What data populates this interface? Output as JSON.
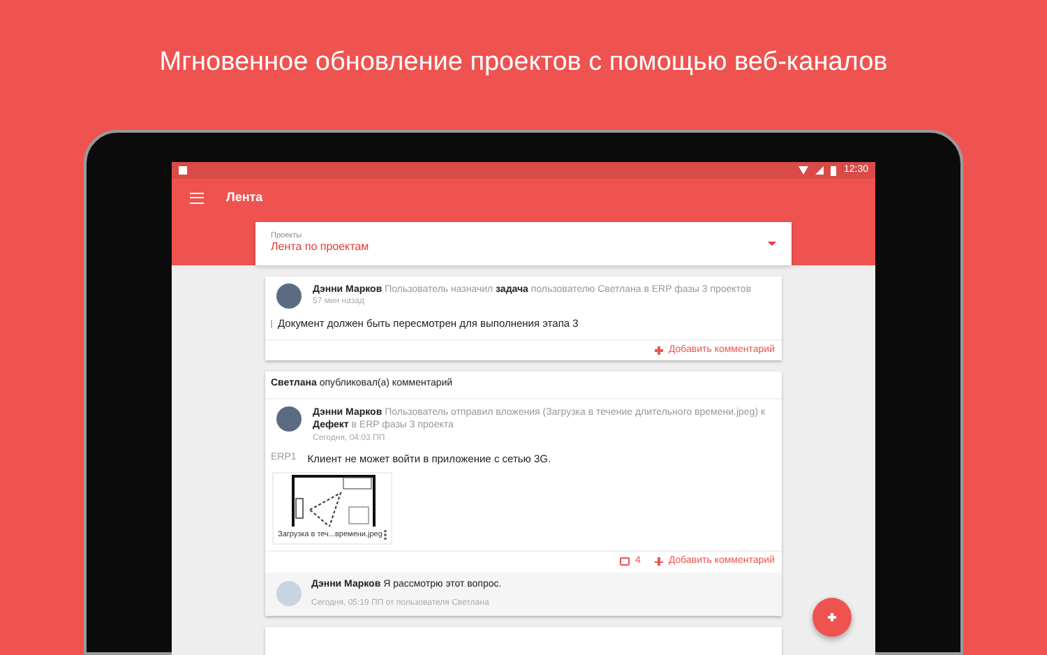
{
  "headline": "Мгновенное обновление проектов с помощью веб-каналов",
  "status_bar": {
    "time": "12:30"
  },
  "app_bar": {
    "title": "Лента"
  },
  "project_select": {
    "label": "Проекты",
    "value": "Лента по проектам"
  },
  "feed": [
    {
      "kind": "activity",
      "author": "Дэнни Марков",
      "action": "Пользователь назначил **задача** пользователю Светлана в ERP фазы 3 проектов",
      "time": "57 мин назад",
      "body": "Документ должен быть пересмотрен для выполнения этапа 3",
      "add_comment": "Добавить комментарий"
    },
    {
      "kind": "comment",
      "header": "**Светлана** опубликовал(а) комментарий",
      "author": "Дэнни Марков",
      "action": "Пользователь отправил вложения (Загрузка в течение длительного времени.jpeg) к **Дефект** в ERP фазы 3 проекта",
      "time": "Сегодня, 04:03 ПП",
      "tag": "ERP1",
      "body": "Клиент не может войти в приложение с сетью 3G.",
      "attachment": "Загрузка в теч...времени.jpeg",
      "comment_count": "4",
      "add_comment": "Добавить комментарий",
      "reply": {
        "author": "Дэнни Марков",
        "text": "Я рассмотрю этот вопрос.",
        "meta": "Сегодня, 05:19 ПП от пользователя Светлана"
      }
    },
    {
      "kind": "cut"
    }
  ]
}
